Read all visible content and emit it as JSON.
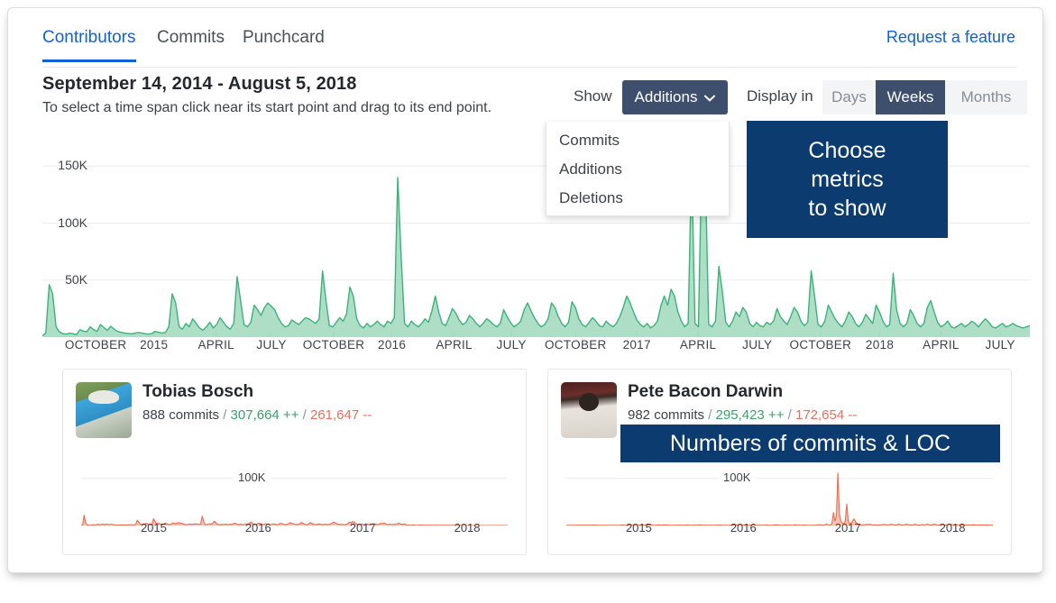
{
  "tabs": [
    {
      "label": "Contributors",
      "active": true
    },
    {
      "label": "Commits",
      "active": false
    },
    {
      "label": "Punchcard",
      "active": false
    }
  ],
  "feature_link": "Request a feature",
  "header": {
    "date_range": "September 14, 2014 - August 5, 2018",
    "instructions": "To select a time span click near its start point and drag to its end point."
  },
  "controls": {
    "show_label": "Show",
    "show_value": "Additions",
    "chevron": "⌄",
    "dropdown_options": [
      "Commits",
      "Additions",
      "Deletions"
    ],
    "display_label": "Display in",
    "display_options": [
      {
        "label": "Days",
        "active": false
      },
      {
        "label": "Weeks",
        "active": true
      },
      {
        "label": "Months",
        "active": false
      }
    ]
  },
  "callouts": {
    "metrics": "Choose\nmetrics\nto show",
    "metrics_lines": [
      "Choose",
      "metrics",
      "to show"
    ],
    "loc": "Numbers of commits & LOC"
  },
  "colors": {
    "accent_blue": "#1160d8",
    "callout_navy": "#0b3b6f",
    "button_slate": "#3e4f6d",
    "additions_green": "#37a169",
    "deletions_red": "#e8705a",
    "area_fill": "#8fd3b0",
    "area_stroke": "#3cb27b",
    "spark_fill": "#fbb7a6",
    "spark_stroke": "#f2694a",
    "gridline": "#ececec"
  },
  "chart_data": {
    "type": "area",
    "title": "September 14, 2014 - August 5, 2018",
    "metric": "Additions",
    "interval": "Weeks",
    "ylabel": "",
    "xlabel": "",
    "ylim": [
      0,
      170000
    ],
    "yticks": [
      50000,
      100000,
      150000
    ],
    "ytick_labels": [
      "50K",
      "100K",
      "150K"
    ],
    "grid": true,
    "legend": "none",
    "xtick_labels": [
      "OCTOBER",
      "2015",
      "APRIL",
      "JULY",
      "OCTOBER",
      "2016",
      "APRIL",
      "JULY",
      "OCTOBER",
      "2017",
      "APRIL",
      "JULY",
      "OCTOBER",
      "2018",
      "APRIL",
      "JULY"
    ],
    "xtick_positions_pct": [
      5.4,
      11.3,
      17.6,
      23.2,
      29.5,
      35.4,
      41.7,
      47.5,
      54.0,
      60.2,
      66.4,
      72.4,
      78.8,
      84.8,
      91.0,
      97.0
    ],
    "values": [
      1200,
      3500,
      46000,
      38000,
      9000,
      4500,
      3000,
      2600,
      3400,
      2900,
      2200,
      6500,
      5200,
      4800,
      9000,
      6500,
      5000,
      11000,
      8500,
      6000,
      9500,
      7000,
      5000,
      4200,
      3600,
      3200,
      2800,
      3400,
      4000,
      3600,
      3000,
      2600,
      3000,
      5000,
      4200,
      3600,
      4000,
      9000,
      38000,
      30000,
      9000,
      7000,
      12000,
      9000,
      16000,
      12000,
      8000,
      6000,
      9000,
      13000,
      8000,
      11000,
      17000,
      13000,
      9000,
      7000,
      12000,
      53000,
      32000,
      11000,
      9000,
      13000,
      28000,
      24000,
      19000,
      26000,
      30000,
      27000,
      24000,
      17000,
      12000,
      9000,
      10000,
      15000,
      13000,
      11000,
      14000,
      17000,
      16000,
      14000,
      12000,
      16000,
      58000,
      32000,
      10000,
      9000,
      13000,
      17000,
      14000,
      20000,
      44000,
      36000,
      16000,
      10000,
      8000,
      12000,
      9000,
      11000,
      14000,
      11000,
      9000,
      14000,
      12000,
      17000,
      140000,
      70000,
      12000,
      9000,
      14000,
      11000,
      9000,
      12000,
      16000,
      13000,
      23000,
      36000,
      22000,
      12000,
      10000,
      17000,
      25000,
      21000,
      15000,
      11000,
      13000,
      19000,
      16000,
      12000,
      9000,
      12000,
      16000,
      14000,
      11000,
      9000,
      12000,
      24000,
      18000,
      13000,
      9000,
      11000,
      14000,
      24000,
      30000,
      23000,
      17000,
      12000,
      9000,
      11000,
      16000,
      30000,
      26000,
      18000,
      12000,
      9000,
      13000,
      31000,
      26000,
      16000,
      11000,
      9000,
      13000,
      17000,
      14000,
      10000,
      9000,
      14000,
      11000,
      9000,
      12000,
      18000,
      26000,
      36000,
      30000,
      22000,
      15000,
      11000,
      9000,
      12000,
      8000,
      10000,
      14000,
      27000,
      36000,
      28000,
      42000,
      36000,
      22000,
      14000,
      9000,
      12000,
      155000,
      12000,
      9000,
      160000,
      148000,
      11000,
      9000,
      14000,
      62000,
      40000,
      13000,
      9000,
      14000,
      22000,
      18000,
      26000,
      22000,
      12000,
      9000,
      13000,
      10000,
      9000,
      13000,
      11000,
      14000,
      25000,
      18000,
      14000,
      11000,
      18000,
      26000,
      22000,
      14000,
      10000,
      13000,
      58000,
      36000,
      11000,
      9000,
      14000,
      28000,
      22000,
      16000,
      12000,
      9000,
      14000,
      22000,
      18000,
      12000,
      9000,
      13000,
      20000,
      16000,
      12000,
      28000,
      22000,
      14000,
      9000,
      11000,
      56000,
      24000,
      12000,
      9000,
      12000,
      24000,
      19000,
      12000,
      9000,
      12000,
      26000,
      32000,
      22000,
      13000,
      9000,
      11000,
      14000,
      9000,
      8000,
      10000,
      12000,
      9000,
      11000,
      14000,
      12000,
      9000,
      13000,
      16000,
      13000,
      9000,
      8000,
      10000,
      12000,
      9000,
      10000,
      12000,
      10000,
      9000,
      8000,
      9000,
      10000
    ]
  },
  "contributors": [
    {
      "name": "Tobias Bosch",
      "commits": "888 commits",
      "additions": "307,664 ++",
      "deletions": "261,647 --",
      "sep": "/",
      "sparkline": {
        "type": "area",
        "ylabel_text": "100K",
        "ylim": [
          0,
          130000
        ],
        "ytick": 100000,
        "xtick_labels": [
          "2015",
          "2016",
          "2017",
          "2018"
        ],
        "xtick_positions_pct": [
          17.0,
          41.5,
          66.0,
          90.5
        ],
        "values": [
          300,
          1000,
          22000,
          6000,
          1200,
          900,
          700,
          900,
          1800,
          1400,
          1100,
          2500,
          2000,
          1600,
          2600,
          2200,
          1600,
          3000,
          2400,
          1800,
          2600,
          2000,
          1500,
          1200,
          1000,
          900,
          800,
          1000,
          1200,
          1100,
          900,
          800,
          900,
          1500,
          1300,
          1100,
          1200,
          2600,
          11000,
          8000,
          2600,
          2000,
          3500,
          2600,
          4600,
          3500,
          2300,
          1700,
          2600,
          14000,
          9000,
          3200,
          5000,
          3800,
          2600,
          2000,
          3400,
          5000,
          3200,
          2200,
          1800,
          2600,
          5600,
          4800,
          3800,
          5200,
          6000,
          5400,
          4800,
          3400,
          2400,
          1800,
          2000,
          3000,
          2600,
          2200,
          2800,
          3400,
          3200,
          2800,
          2400,
          3200,
          20000,
          9000,
          2000,
          1800,
          2600,
          3400,
          2800,
          4000,
          8800,
          7200,
          3200,
          2000,
          1600,
          2400,
          1800,
          2200,
          2800,
          2200,
          1800,
          2800,
          2400,
          3400,
          5000,
          3600,
          2400,
          1800,
          2800,
          2200,
          1800,
          2400,
          3200,
          2600,
          4600,
          7200,
          4400,
          2400,
          2000,
          3400,
          5000,
          4200,
          3000,
          2200,
          2600,
          3800,
          3200,
          2400,
          1800,
          2400,
          3200,
          2800,
          2200,
          1800,
          2400,
          4800,
          3600,
          2600,
          1800,
          2200,
          2800,
          4800,
          6000,
          4600,
          3400,
          2400,
          1800,
          2200,
          3200,
          6000,
          5200,
          3600,
          2400,
          1800,
          2600,
          6200,
          5200,
          3200,
          2200,
          1800,
          2600,
          3400,
          2800,
          2000,
          1800,
          2800,
          2200,
          1800,
          2400,
          3600,
          5200,
          7200,
          6000,
          4400,
          3000,
          2200,
          1800,
          2400,
          1600,
          2000,
          2800,
          5400,
          7200,
          5600,
          8400,
          7200,
          4400,
          2800,
          1800,
          2400,
          3200,
          2400,
          1800,
          3200,
          3000,
          2200,
          1800,
          2800,
          4000,
          3000,
          2600,
          1800,
          2800,
          4400,
          3600,
          5200,
          4400,
          2400,
          1800,
          2600,
          2000,
          1800,
          2600,
          2200,
          2800,
          5000,
          3600,
          2800,
          2200,
          3600,
          1600,
          1200,
          900,
          700,
          800,
          1400,
          900,
          600,
          500,
          700,
          900,
          700,
          500,
          400,
          500,
          600,
          500,
          400,
          450,
          500,
          600,
          500,
          400,
          350,
          400,
          450,
          400,
          350,
          300,
          350,
          400,
          350,
          300,
          280,
          320,
          360,
          320,
          280,
          260,
          300,
          0,
          0,
          0,
          0,
          0,
          0,
          0,
          0,
          0,
          0,
          0,
          0,
          0,
          0,
          0,
          0,
          0,
          0,
          0,
          0,
          0,
          0,
          0,
          0,
          0,
          0,
          0,
          0,
          0,
          0
        ]
      }
    },
    {
      "name": "Pete Bacon Darwin",
      "commits": "982 commits",
      "additions": "295,423 ++",
      "deletions": "172,654 --",
      "sep": "/",
      "sparkline": {
        "type": "area",
        "ylabel_text": "100K",
        "ylim": [
          0,
          130000
        ],
        "ytick": 100000,
        "xtick_labels": [
          "2015",
          "2016",
          "2017",
          "2018"
        ],
        "xtick_positions_pct": [
          17.0,
          41.5,
          66.0,
          90.5
        ],
        "values": [
          200,
          300,
          400,
          500,
          400,
          300,
          350,
          500,
          700,
          600,
          500,
          700,
          600,
          500,
          800,
          700,
          500,
          900,
          800,
          600,
          900,
          700,
          500,
          400,
          350,
          300,
          280,
          350,
          420,
          380,
          300,
          280,
          320,
          500,
          450,
          380,
          420,
          900,
          1200,
          900,
          600,
          500,
          800,
          600,
          1000,
          800,
          500,
          400,
          600,
          900,
          600,
          800,
          1200,
          900,
          600,
          500,
          800,
          1100,
          800,
          550,
          450,
          650,
          1300,
          1100,
          900,
          1200,
          1400,
          1200,
          1100,
          800,
          560,
          420,
          480,
          700,
          600,
          520,
          650,
          800,
          750,
          650,
          560,
          750,
          1300,
          900,
          480,
          420,
          600,
          800,
          650,
          950,
          1600,
          1300,
          750,
          480,
          380,
          560,
          420,
          520,
          650,
          520,
          420,
          650,
          560,
          800,
          1200,
          850,
          560,
          420,
          650,
          520,
          420,
          560,
          750,
          600,
          1100,
          1700,
          1000,
          560,
          480,
          800,
          1200,
          1000,
          700,
          520,
          600,
          900,
          750,
          560,
          420,
          560,
          750,
          650,
          520,
          420,
          560,
          1100,
          850,
          600,
          420,
          520,
          650,
          1100,
          1400,
          1100,
          800,
          560,
          420,
          520,
          750,
          1400,
          1200,
          850,
          560,
          420,
          600,
          1450,
          1200,
          750,
          520,
          420,
          600,
          800,
          650,
          480,
          420,
          650,
          520,
          420,
          560,
          850,
          1200,
          1700,
          1400,
          1000,
          700,
          520,
          3400,
          2200,
          1200,
          900,
          4200,
          28000,
          9000,
          20000,
          112000,
          26000,
          9000,
          5200,
          4000,
          9000,
          46000,
          9000,
          4000,
          5200,
          9000,
          14000,
          7200,
          4200,
          2600,
          1800,
          1400,
          1100,
          1600,
          2200,
          1800,
          2600,
          2200,
          1400,
          1000,
          1400,
          1100,
          950,
          1400,
          1200,
          1500,
          2500,
          1800,
          1400,
          1100,
          1800,
          2600,
          2200,
          1400,
          1000,
          1300,
          2900,
          1800,
          1100,
          900,
          1400,
          2800,
          2200,
          1600,
          1200,
          900,
          1400,
          2200,
          1800,
          1200,
          900,
          1300,
          2000,
          1600,
          1200,
          2800,
          2200,
          1400,
          900,
          1100,
          2800,
          2400,
          1200,
          900,
          1200,
          2400,
          1900,
          1200,
          900,
          1200,
          2600,
          3200,
          2200,
          1300,
          900,
          1100,
          1400,
          900,
          800,
          1000,
          1200,
          900,
          1100,
          1400,
          1200,
          900,
          1300,
          1600,
          1300,
          900,
          800,
          1000,
          1200,
          900,
          1000,
          1200,
          1000,
          900,
          800,
          900,
          1000
        ]
      }
    }
  ]
}
